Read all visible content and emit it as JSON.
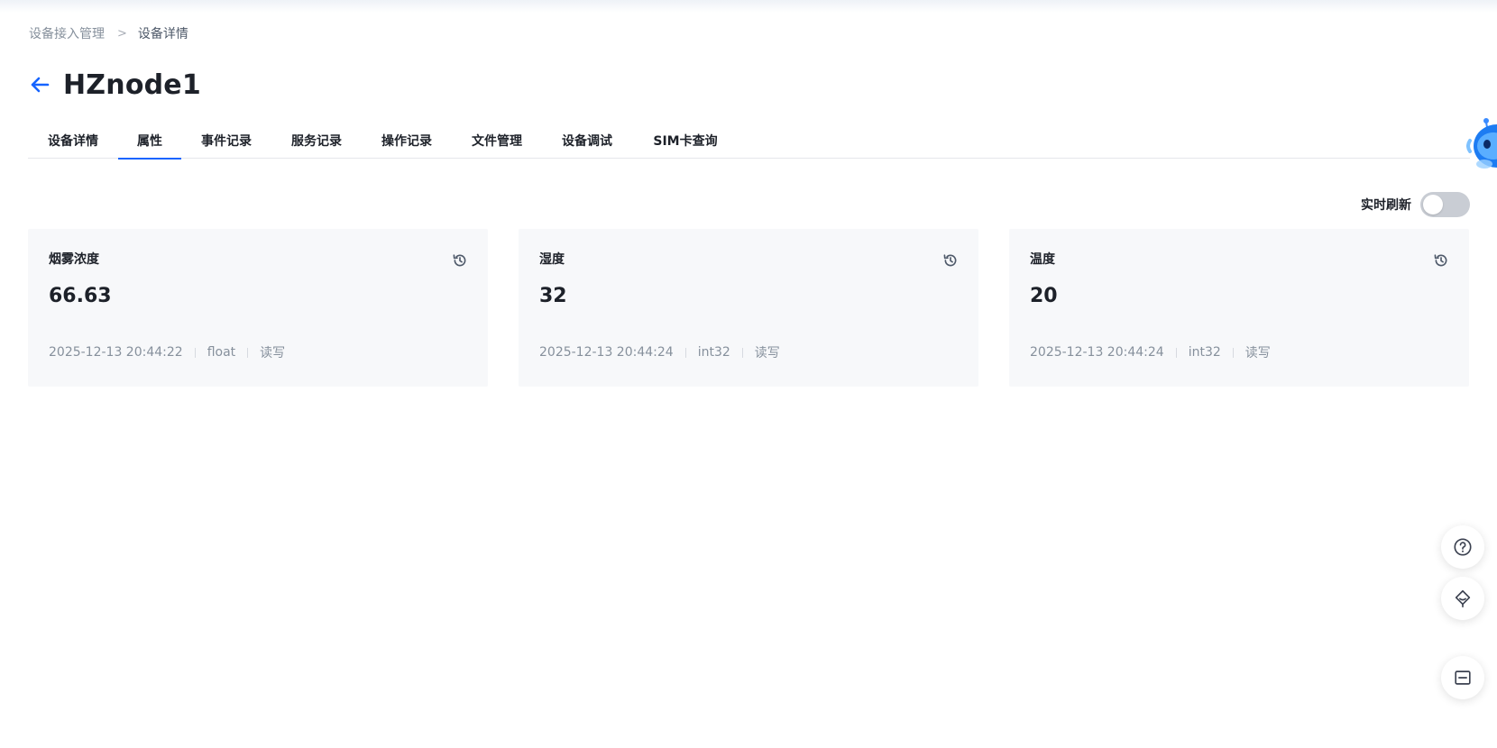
{
  "breadcrumb": {
    "parent": "设备接入管理",
    "separator": ">",
    "current": "设备详情"
  },
  "page": {
    "title": "HZnode1"
  },
  "tabs": [
    {
      "label": "设备详情",
      "active": false
    },
    {
      "label": "属性",
      "active": true
    },
    {
      "label": "事件记录",
      "active": false
    },
    {
      "label": "服务记录",
      "active": false
    },
    {
      "label": "操作记录",
      "active": false
    },
    {
      "label": "文件管理",
      "active": false
    },
    {
      "label": "设备调试",
      "active": false
    },
    {
      "label": "SIM卡查询",
      "active": false
    }
  ],
  "realtime_refresh": {
    "label": "实时刷新",
    "enabled": false
  },
  "properties": [
    {
      "name": "烟雾浓度",
      "value": "66.63",
      "timestamp": "2025-12-13 20:44:22",
      "type": "float",
      "access": "读写"
    },
    {
      "name": "湿度",
      "value": "32",
      "timestamp": "2025-12-13 20:44:24",
      "type": "int32",
      "access": "读写"
    },
    {
      "name": "温度",
      "value": "20",
      "timestamp": "2025-12-13 20:44:24",
      "type": "int32",
      "access": "读写"
    }
  ],
  "icons": {
    "back": "arrow-left-icon",
    "history": "history-icon",
    "help": "question-circle-icon",
    "service": "customer-service-icon",
    "collapse": "minus-square-icon",
    "assistant": "robot-assistant-icon"
  },
  "colors": {
    "accent": "#1664ff",
    "card_bg": "#f7f8fa",
    "switch_off": "#c9cdd4"
  }
}
